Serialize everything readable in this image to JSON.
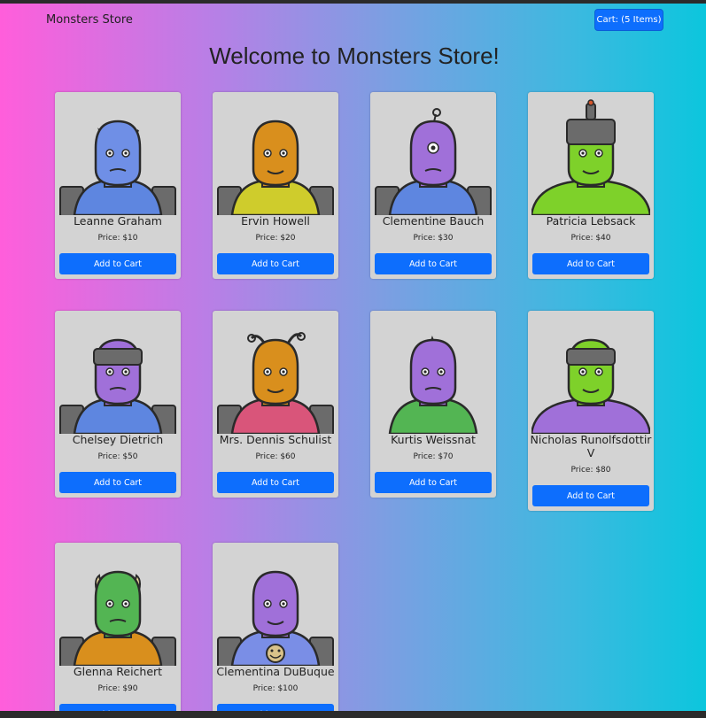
{
  "navbar": {
    "brand": "Monsters Store",
    "cart_label": "Cart: (5 Items)"
  },
  "page_title": "Welcome to Monsters Store!",
  "add_label": "Add to Cart",
  "colors": {
    "accent": "#0d6efd",
    "card_bg": "#d3d3d3",
    "gradient_start": "#ff5edb",
    "gradient_end": "#0cc6dd"
  },
  "monsters": [
    {
      "name": "Leanne Graham",
      "price": "Price: $10",
      "head": "#6f8fe6",
      "body": "#5e86e0",
      "image": "monster-blue-horns"
    },
    {
      "name": "Ervin Howell",
      "price": "Price: $20",
      "head": "#d98f1d",
      "body": "#cfcc2c",
      "image": "monster-orange-yellow"
    },
    {
      "name": "Clementine Bauch",
      "price": "Price: $30",
      "head": "#a070d9",
      "body": "#5e86e0",
      "image": "monster-purple-cyclops"
    },
    {
      "name": "Patricia Lebsack",
      "price": "Price: $40",
      "head": "#7ed12a",
      "body": "#7ed12a",
      "image": "monster-green-helmet"
    },
    {
      "name": "Chelsey Dietrich",
      "price": "Price: $50",
      "head": "#a070d9",
      "body": "#5e86e0",
      "image": "monster-purple-helmet"
    },
    {
      "name": "Mrs. Dennis Schulist",
      "price": "Price: $60",
      "head": "#d98f1d",
      "body": "#d9557a",
      "image": "monster-orange-antennae"
    },
    {
      "name": "Kurtis Weissnat",
      "price": "Price: $70",
      "head": "#a070d9",
      "body": "#53b553",
      "image": "monster-purple-horn"
    },
    {
      "name": "Nicholas Runolfsdottir V",
      "price": "Price: $80",
      "head": "#7ed12a",
      "body": "#a070d9",
      "image": "monster-green-purple"
    },
    {
      "name": "Glenna Reichert",
      "price": "Price: $90",
      "head": "#53b553",
      "body": "#d98f1d",
      "image": "monster-green-horns"
    },
    {
      "name": "Clementina DuBuque",
      "price": "Price: $100",
      "head": "#a070d9",
      "body": "#7a8ee6",
      "image": "monster-purple-smiley"
    }
  ]
}
